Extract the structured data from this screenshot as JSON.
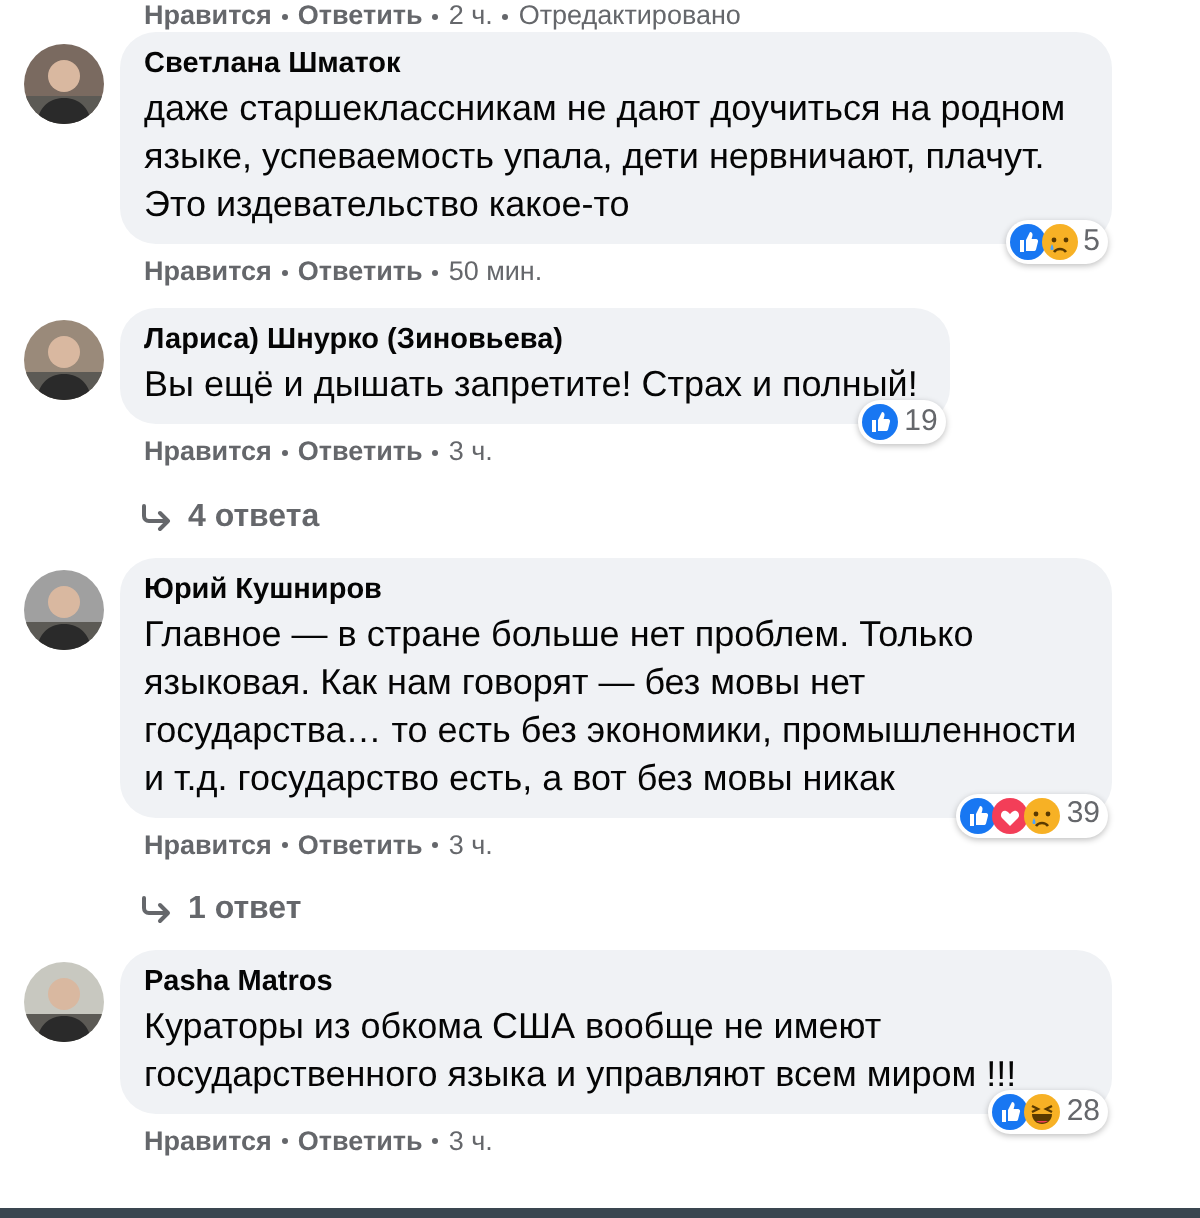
{
  "top_actions": {
    "like": "Нравится",
    "reply": "Ответить",
    "time": "2 ч.",
    "edited": "Отредактировано"
  },
  "comments": [
    {
      "author": "Светлана Шматок",
      "text": "даже старшеклассникам не дают доучиться на родном языке, успеваемость упала, дети нервничают, плачут. Это издевательство какое-то",
      "reactions": [
        {
          "kind": "like"
        },
        {
          "kind": "sad"
        }
      ],
      "reaction_count": "5",
      "actions": {
        "like": "Нравится",
        "reply": "Ответить",
        "time": "50 мин."
      }
    },
    {
      "author": "Лариса) Шнурко (Зиновьева)",
      "text": "Вы ещё и дышать запретите! Страх и полный!",
      "reactions": [
        {
          "kind": "like"
        }
      ],
      "reaction_count": "19",
      "actions": {
        "like": "Нравится",
        "reply": "Ответить",
        "time": "3 ч."
      },
      "replies": "4 ответа"
    },
    {
      "author": "Юрий Кушниров",
      "text": "Главное — в стране больше нет проблем. Только языковая. Как нам говорят — без мовы нет государства… то есть без экономики, промышленности и т.д. государство есть, а вот без мовы никак",
      "reactions": [
        {
          "kind": "like"
        },
        {
          "kind": "love"
        },
        {
          "kind": "sad"
        }
      ],
      "reaction_count": "39",
      "actions": {
        "like": "Нравится",
        "reply": "Ответить",
        "time": "3 ч."
      },
      "replies": "1 ответ"
    },
    {
      "author": "Pasha Matros",
      "text": "Кураторы из обкома США вообще не имеют государственного языка и управляют всем миром !!!",
      "reactions": [
        {
          "kind": "like"
        },
        {
          "kind": "haha"
        }
      ],
      "reaction_count": "28",
      "actions": {
        "like": "Нравится",
        "reply": "Ответить",
        "time": "3 ч."
      }
    }
  ]
}
